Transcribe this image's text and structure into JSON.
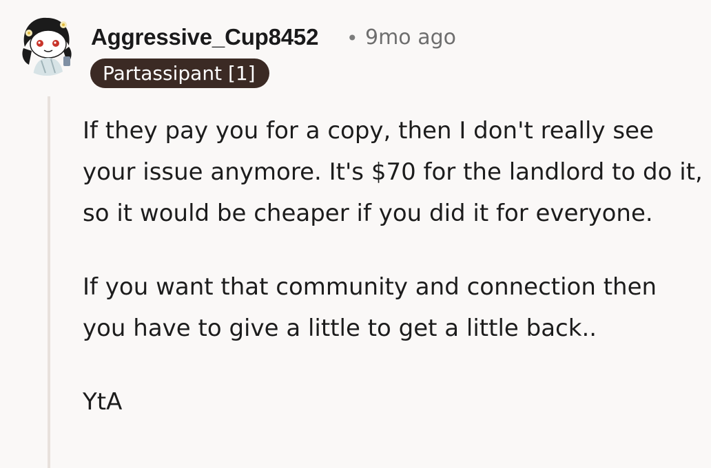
{
  "comment": {
    "author": "Aggressive_Cup8452",
    "separator": "•",
    "timestamp": "9mo ago",
    "flair": "Partassipant [1]",
    "paragraphs": [
      "If they pay you for a copy, then I don't really see your issue anymore. It's $70 for the landlord to do it, so it would be cheaper if you did it for everyone.",
      "If you want that community and connection then you have to give a little to get a little back..",
      "YtA"
    ],
    "avatar_icon": "user-avatar-icon"
  },
  "colors": {
    "background": "#faf8f7",
    "flair_background": "#3b2a24",
    "flair_text": "#ffffff",
    "thread_line": "#e8e1dc",
    "meta_text": "#6e6e6e"
  }
}
